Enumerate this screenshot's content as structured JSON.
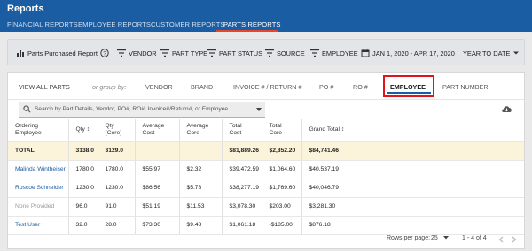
{
  "app": {
    "title": "Reports"
  },
  "nav": {
    "tabs": [
      {
        "label": "FINANCIAL REPORTS"
      },
      {
        "label": "EMPLOYEE REPORTS"
      },
      {
        "label": "CUSTOMER REPORTS"
      },
      {
        "label": "PARTS REPORTS",
        "active": true
      }
    ]
  },
  "toolbar": {
    "report": "Parts Purchased Report",
    "vendor": "VENDOR",
    "part_type": "PART TYPE",
    "part_status": "PART STATUS",
    "source": "SOURCE",
    "employee": "EMPLOYEE",
    "date_range": "JAN 1, 2020 - APR 17, 2020",
    "period": "YEAR TO DATE"
  },
  "group_by": {
    "view_all": "VIEW ALL PARTS",
    "or_group_by": "or group by:",
    "options": [
      "VENDOR",
      "BRAND",
      "INVOICE # / RETURN #",
      "PO #",
      "RO #",
      "EMPLOYEE",
      "PART NUMBER"
    ],
    "active": "EMPLOYEE"
  },
  "search": {
    "placeholder": "Search by Part Details, Vendor, PO#, RO#, Invoice#/Return#, or Employee"
  },
  "table": {
    "headers": [
      [
        "Ordering",
        "Employee"
      ],
      [
        "Qty",
        ""
      ],
      [
        "Qty",
        "(Core)"
      ],
      [
        "Average",
        "Cost"
      ],
      [
        "Average",
        "Core"
      ],
      [
        "Total",
        "Cost"
      ],
      [
        "Total",
        "Core"
      ],
      [
        "Grand Total",
        ""
      ]
    ],
    "sort_indicator": "↕",
    "total": {
      "label": "TOTAL",
      "qty": "3138.0",
      "qty_core": "3129.0",
      "avg_cost": "",
      "avg_core": "",
      "total_cost": "$81,889.26",
      "total_core": "$2,852.20",
      "grand_total": "$84,741.46"
    },
    "rows": [
      {
        "employee": "Malinda Wintheiser",
        "qty": "1780.0",
        "qty_core": "1780.0",
        "avg_cost": "$55.97",
        "avg_core": "$2.32",
        "total_cost": "$39,472.59",
        "total_core": "$1,064.60",
        "grand_total": "$40,537.19"
      },
      {
        "employee": "Roscoe Schneider",
        "qty": "1230.0",
        "qty_core": "1230.0",
        "avg_cost": "$86.56",
        "avg_core": "$5.78",
        "total_cost": "$38,277.19",
        "total_core": "$1,769.60",
        "grand_total": "$40,046.79"
      },
      {
        "employee": "None Provided",
        "qty": "96.0",
        "qty_core": "91.0",
        "avg_cost": "$51.19",
        "avg_core": "$11.53",
        "total_cost": "$3,078.30",
        "total_core": "$203.00",
        "grand_total": "$3,281.30"
      },
      {
        "employee": "Test User",
        "qty": "32.0",
        "qty_core": "28.0",
        "avg_cost": "$73.30",
        "avg_core": "$9.48",
        "total_cost": "$1,061.18",
        "total_core": "-$185.00",
        "grand_total": "$876.18"
      }
    ]
  },
  "pager": {
    "rows_label": "Rows per page:",
    "rows_value": "25",
    "range": "1 - 4 of 4"
  },
  "colors": {
    "header_bg": "#1b5da3",
    "accent": "#e8452c",
    "highlight_box": "#e0141c",
    "total_row_bg": "#fcf4da",
    "link": "#1b5da3"
  }
}
